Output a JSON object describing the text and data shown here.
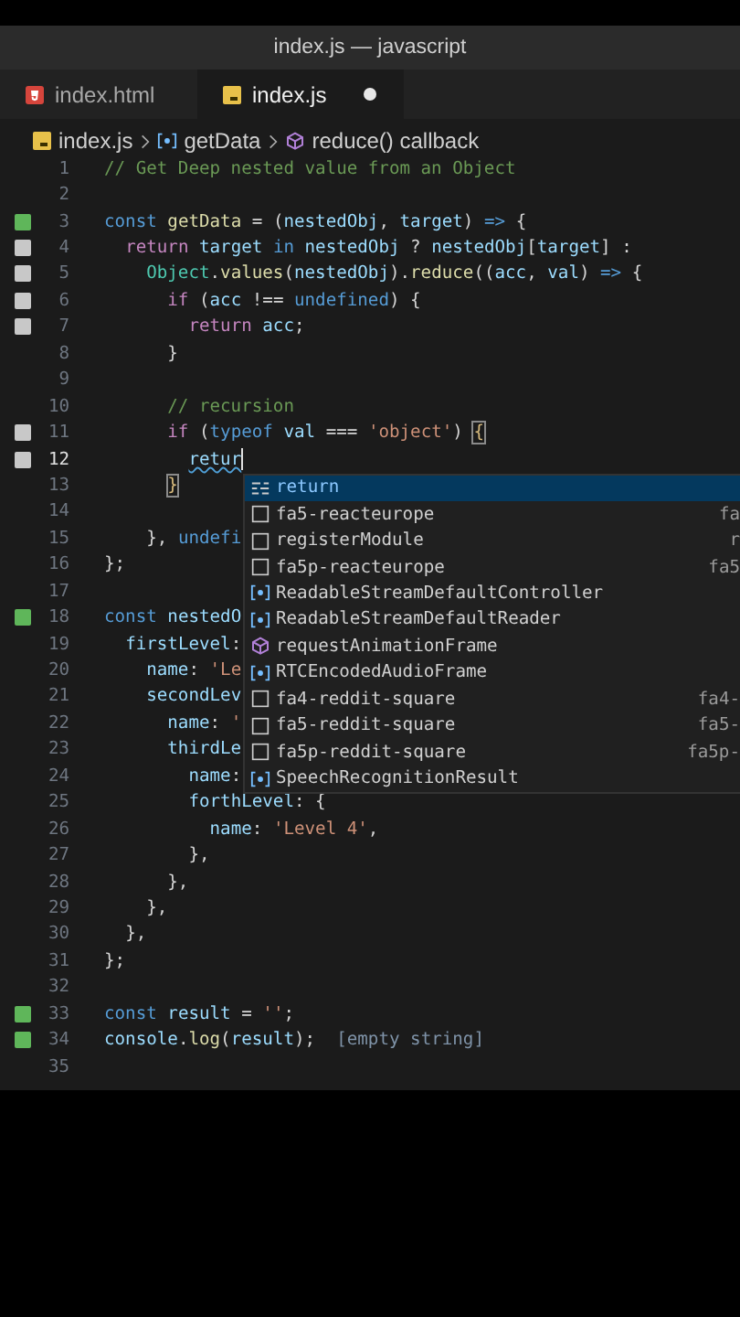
{
  "window": {
    "title": "index.js — javascript"
  },
  "tabs": [
    {
      "label": "index.html",
      "kind": "html",
      "selected": false,
      "dirty": false
    },
    {
      "label": "index.js",
      "kind": "js",
      "selected": true,
      "dirty": true
    }
  ],
  "breadcrumb": [
    {
      "label": "index.js",
      "kind": "file"
    },
    {
      "label": "getData",
      "kind": "variable"
    },
    {
      "label": "reduce() callback",
      "kind": "method"
    }
  ],
  "lines": [
    {
      "number": "1",
      "tokens": [
        {
          "kind": "comment",
          "t": "// Get Deep nested value from an Object"
        }
      ]
    },
    {
      "number": "2"
    },
    {
      "number": "3",
      "added": true,
      "tokens": [
        {
          "kind": "keyword",
          "t": "const"
        },
        {
          "kind": "function",
          "t": " getData"
        },
        {
          "kind": "plain",
          "t": " = ("
        },
        {
          "kind": "variable",
          "t": "nestedObj"
        },
        {
          "kind": "plain",
          "t": ", "
        },
        {
          "kind": "variable",
          "t": "target"
        },
        {
          "kind": "plain",
          "t": ") "
        },
        {
          "kind": "keyword",
          "t": "=>"
        },
        {
          "kind": "plain",
          "t": " {"
        }
      ]
    },
    {
      "number": "4",
      "modified": true,
      "tokens": [
        {
          "kind": "control",
          "t": "  return"
        },
        {
          "kind": "variable",
          "t": " target"
        },
        {
          "kind": "keyword",
          "t": " in"
        },
        {
          "kind": "variable",
          "t": " nestedObj"
        },
        {
          "kind": "plain",
          "t": " ? "
        },
        {
          "kind": "variable",
          "t": "nestedObj"
        },
        {
          "kind": "plain",
          "t": "["
        },
        {
          "kind": "variable",
          "t": "target"
        },
        {
          "kind": "plain",
          "t": "] :"
        }
      ]
    },
    {
      "number": "5",
      "modified": true,
      "tokens": [
        {
          "kind": "class",
          "t": "    Object"
        },
        {
          "kind": "plain",
          "t": "."
        },
        {
          "kind": "function",
          "t": "values"
        },
        {
          "kind": "plain",
          "t": "("
        },
        {
          "kind": "variable",
          "t": "nestedObj"
        },
        {
          "kind": "plain",
          "t": ")."
        },
        {
          "kind": "function",
          "t": "reduce"
        },
        {
          "kind": "plain",
          "t": "(("
        },
        {
          "kind": "variable",
          "t": "acc"
        },
        {
          "kind": "plain",
          "t": ", "
        },
        {
          "kind": "variable",
          "t": "val"
        },
        {
          "kind": "plain",
          "t": ") "
        },
        {
          "kind": "keyword",
          "t": "=>"
        },
        {
          "kind": "plain",
          "t": " {"
        }
      ]
    },
    {
      "number": "6",
      "modified": true,
      "tokens": [
        {
          "kind": "control",
          "t": "      if"
        },
        {
          "kind": "plain",
          "t": " ("
        },
        {
          "kind": "variable",
          "t": "acc"
        },
        {
          "kind": "plain",
          "t": " !== "
        },
        {
          "kind": "keyword",
          "t": "undefined"
        },
        {
          "kind": "plain",
          "t": ") {"
        }
      ]
    },
    {
      "number": "7",
      "modified": true,
      "tokens": [
        {
          "kind": "control",
          "t": "        return"
        },
        {
          "kind": "variable",
          "t": " acc"
        },
        {
          "kind": "plain",
          "t": ";"
        }
      ]
    },
    {
      "number": "8",
      "tokens": [
        {
          "kind": "plain",
          "t": "      }"
        }
      ]
    },
    {
      "number": "9"
    },
    {
      "number": "10",
      "tokens": [
        {
          "kind": "comment",
          "t": "      // recursion"
        }
      ]
    },
    {
      "number": "11",
      "modified": true,
      "tokens": [
        {
          "kind": "control",
          "t": "      if"
        },
        {
          "kind": "plain",
          "t": " ("
        },
        {
          "kind": "keyword",
          "t": "typeof"
        },
        {
          "kind": "variable",
          "t": " val"
        },
        {
          "kind": "plain",
          "t": " === "
        },
        {
          "kind": "string",
          "t": "'object'"
        },
        {
          "kind": "plain",
          "t": ") "
        },
        {
          "kind": "bracket",
          "t": "{"
        }
      ]
    },
    {
      "number": "12",
      "modified": true,
      "current": true,
      "tokens": [
        {
          "kind": "error",
          "t": "        retur"
        }
      ]
    },
    {
      "number": "13",
      "tokens": [
        {
          "kind": "bracket",
          "t": "      }"
        }
      ]
    },
    {
      "number": "14"
    },
    {
      "number": "15",
      "tokens": [
        {
          "kind": "plain",
          "t": "    }, "
        },
        {
          "kind": "keyword",
          "t": "undefi"
        }
      ]
    },
    {
      "number": "16",
      "tokens": [
        {
          "kind": "plain",
          "t": "};"
        }
      ]
    },
    {
      "number": "17"
    },
    {
      "number": "18",
      "added": true,
      "tokens": [
        {
          "kind": "keyword",
          "t": "const"
        },
        {
          "kind": "variable",
          "t": " nestedO"
        }
      ]
    },
    {
      "number": "19",
      "tokens": [
        {
          "kind": "variable",
          "t": "  firstLevel"
        },
        {
          "kind": "plain",
          "t": ":"
        }
      ]
    },
    {
      "number": "20",
      "tokens": [
        {
          "kind": "variable",
          "t": "    name"
        },
        {
          "kind": "plain",
          "t": ": "
        },
        {
          "kind": "string",
          "t": "'Le"
        }
      ]
    },
    {
      "number": "21",
      "tokens": [
        {
          "kind": "variable",
          "t": "    secondLev"
        }
      ]
    },
    {
      "number": "22",
      "tokens": [
        {
          "kind": "variable",
          "t": "      name"
        },
        {
          "kind": "plain",
          "t": ": "
        },
        {
          "kind": "string",
          "t": "'"
        }
      ]
    },
    {
      "number": "23",
      "tokens": [
        {
          "kind": "variable",
          "t": "      thirdLe"
        }
      ]
    },
    {
      "number": "24",
      "tokens": [
        {
          "kind": "variable",
          "t": "        name"
        },
        {
          "kind": "plain",
          "t": ":"
        }
      ]
    },
    {
      "number": "25",
      "tokens": [
        {
          "kind": "variable",
          "t": "        forthLevel"
        },
        {
          "kind": "plain",
          "t": ": {"
        }
      ]
    },
    {
      "number": "26",
      "tokens": [
        {
          "kind": "variable",
          "t": "          name"
        },
        {
          "kind": "plain",
          "t": ": "
        },
        {
          "kind": "string",
          "t": "'Level 4'"
        },
        {
          "kind": "plain",
          "t": ","
        }
      ]
    },
    {
      "number": "27",
      "tokens": [
        {
          "kind": "plain",
          "t": "        },"
        }
      ]
    },
    {
      "number": "28",
      "tokens": [
        {
          "kind": "plain",
          "t": "      },"
        }
      ]
    },
    {
      "number": "29",
      "tokens": [
        {
          "kind": "plain",
          "t": "    },"
        }
      ]
    },
    {
      "number": "30",
      "tokens": [
        {
          "kind": "plain",
          "t": "  },"
        }
      ]
    },
    {
      "number": "31",
      "tokens": [
        {
          "kind": "plain",
          "t": "};"
        }
      ]
    },
    {
      "number": "32"
    },
    {
      "number": "33",
      "added": true,
      "tokens": [
        {
          "kind": "keyword",
          "t": "const"
        },
        {
          "kind": "variable",
          "t": " result"
        },
        {
          "kind": "plain",
          "t": " = "
        },
        {
          "kind": "string",
          "t": "''"
        },
        {
          "kind": "plain",
          "t": ";"
        }
      ]
    },
    {
      "number": "34",
      "added": true,
      "tokens": [
        {
          "kind": "variable",
          "t": "console"
        },
        {
          "kind": "plain",
          "t": "."
        },
        {
          "kind": "function",
          "t": "log"
        },
        {
          "kind": "plain",
          "t": "("
        },
        {
          "kind": "variable",
          "t": "result"
        },
        {
          "kind": "plain",
          "t": ");"
        },
        {
          "kind": "hint",
          "t": "  [empty string]"
        }
      ]
    },
    {
      "number": "35"
    }
  ],
  "suggestions": [
    {
      "label": "return",
      "kind": "keyword",
      "selected": true
    },
    {
      "label": "fa5-reacteurope",
      "kind": "snippet",
      "detail": "fa",
      "selected": false
    },
    {
      "label": "registerModule",
      "kind": "snippet",
      "detail": "r",
      "selected": false
    },
    {
      "label": "fa5p-reacteurope",
      "kind": "snippet",
      "detail": "fa5",
      "selected": false
    },
    {
      "label": "ReadableStreamDefaultController",
      "kind": "variable",
      "selected": false
    },
    {
      "label": "ReadableStreamDefaultReader",
      "kind": "variable",
      "selected": false
    },
    {
      "label": "requestAnimationFrame",
      "kind": "method",
      "selected": false
    },
    {
      "label": "RTCEncodedAudioFrame",
      "kind": "variable",
      "selected": false
    },
    {
      "label": "fa4-reddit-square",
      "kind": "snippet",
      "detail": "fa4-",
      "selected": false
    },
    {
      "label": "fa5-reddit-square",
      "kind": "snippet",
      "detail": "fa5-",
      "selected": false
    },
    {
      "label": "fa5p-reddit-square",
      "kind": "snippet",
      "detail": "fa5p-",
      "selected": false
    },
    {
      "label": "SpeechRecognitionResult",
      "kind": "variable",
      "selected": false
    }
  ]
}
